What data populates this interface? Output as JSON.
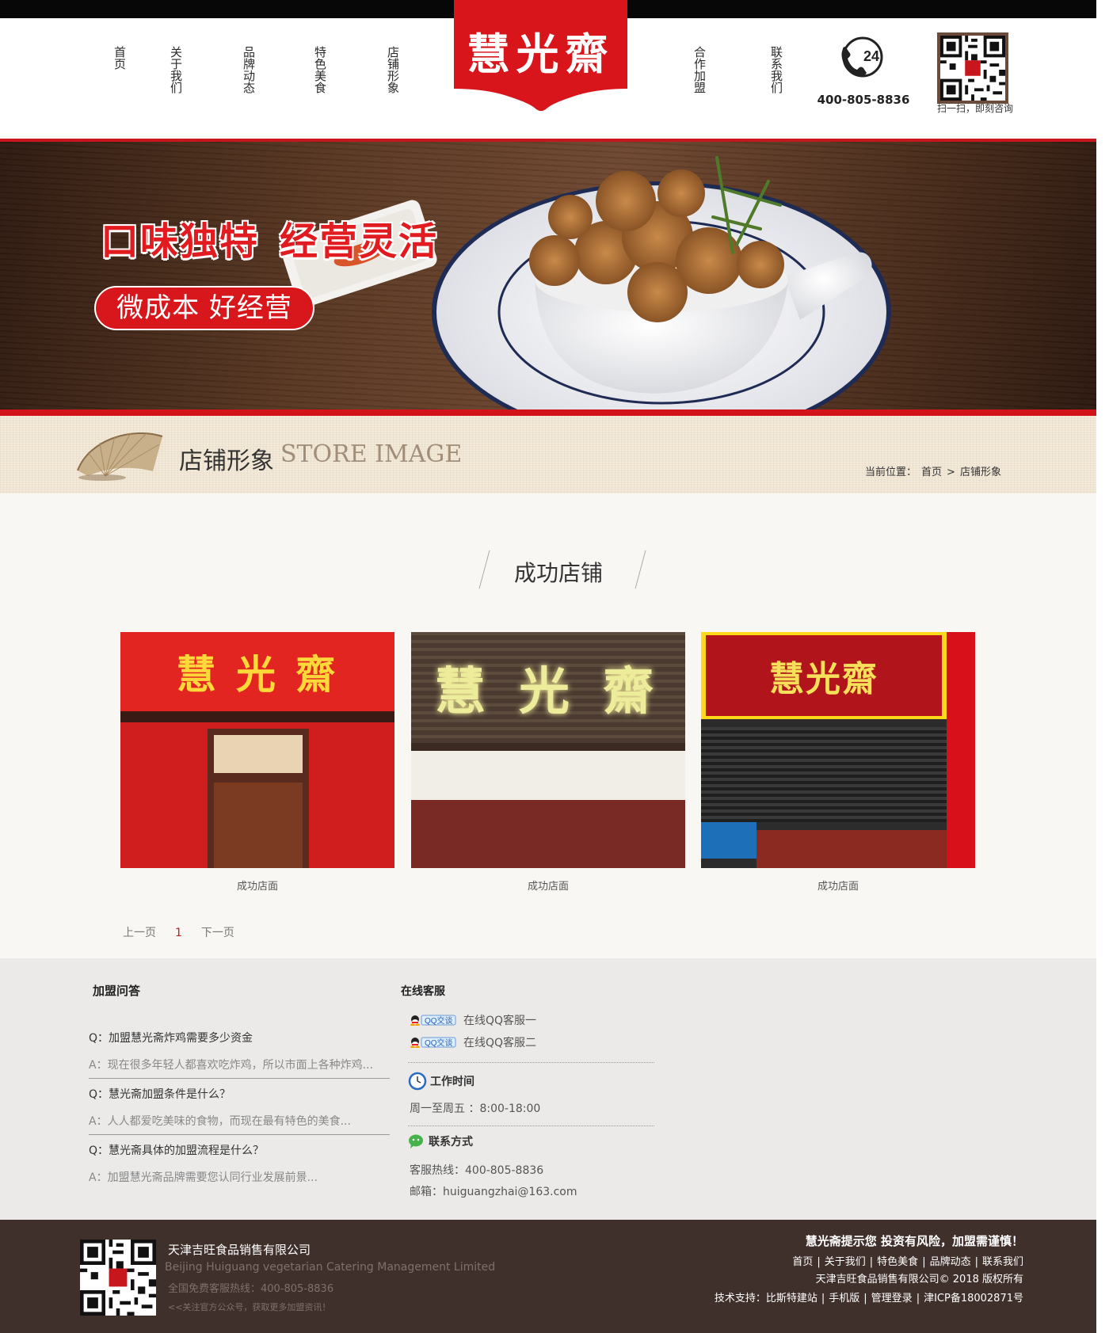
{
  "header": {
    "nav_left": [
      "首页",
      "关于我们",
      "品牌动态",
      "特色美食",
      "店铺形象"
    ],
    "nav_right": [
      "合作加盟",
      "联系我们"
    ],
    "logo_text": "慧光齋",
    "phone_badge": "24",
    "phone": "400-805-8836",
    "qr_caption": "扫一扫，即刻咨询"
  },
  "banner": {
    "headline_1": "口味独特",
    "headline_2": "经营灵活",
    "pill": "微成本 好经营"
  },
  "page_title": {
    "cn": "店铺形象",
    "en": "STORE IMAGE",
    "breadcrumb_label": "当前位置：",
    "breadcrumb_home": "首页",
    "breadcrumb_sep": ">",
    "breadcrumb_current": "店铺形象"
  },
  "section": {
    "heading": "成功店铺"
  },
  "stores": [
    {
      "sign": "慧 光 齋",
      "caption": "成功店面"
    },
    {
      "sign": "慧 光 齋",
      "caption": "成功店面"
    },
    {
      "sign": "慧光齋",
      "caption": "成功店面"
    }
  ],
  "pager": {
    "prev": "上一页",
    "current": "1",
    "next": "下一页"
  },
  "faq": {
    "title": "加盟问答",
    "items": [
      {
        "q": "Q：加盟慧光斋炸鸡需要多少资金",
        "a": "A：现在很多年轻人都喜欢吃炸鸡，所以市面上各种炸鸡..."
      },
      {
        "q": "Q：慧光斋加盟条件是什么？",
        "a": "A：人人都爱吃美味的食物，而现在最有特色的美食..."
      },
      {
        "q": "Q：慧光斋具体的加盟流程是什么？",
        "a": "A：加盟慧光斋品牌需要您认同行业发展前景..."
      }
    ]
  },
  "service": {
    "title": "在线客服",
    "qq_badge": "QQ交谈",
    "qq1": "在线QQ客服一",
    "qq2": "在线QQ客服二",
    "hours_title": "工作时间",
    "hours": "周一至周五 ：8:00-18:00",
    "contact_title": "联系方式",
    "hotline": "客服热线：400-805-8836",
    "email": "邮箱：huiguangzhai@163.com"
  },
  "footer": {
    "company": "天津吉旺食品销售有限公司",
    "company_en": "Beijing Huiguang vegetarian Catering Management Limited",
    "hotline": "全国免费客服热线：400-805-8836",
    "follow": "<<关注官方公众号，获取更多加盟资讯！",
    "warning": "慧光斋提示您 投资有风险，加盟需谨慎！",
    "links": [
      "首页",
      "关于我们",
      "特色美食",
      "品牌动态",
      "联系我们"
    ],
    "copyright": "天津吉旺食品销售有限公司© 2018 版权所有",
    "tech": [
      "技术支持：比斯特建站",
      "手机版",
      "管理登录",
      "津ICP备18002871号"
    ]
  },
  "colors": {
    "brand_red": "#c8161d",
    "footer_brown": "#40302b",
    "title_beige": "#efe5d3"
  }
}
